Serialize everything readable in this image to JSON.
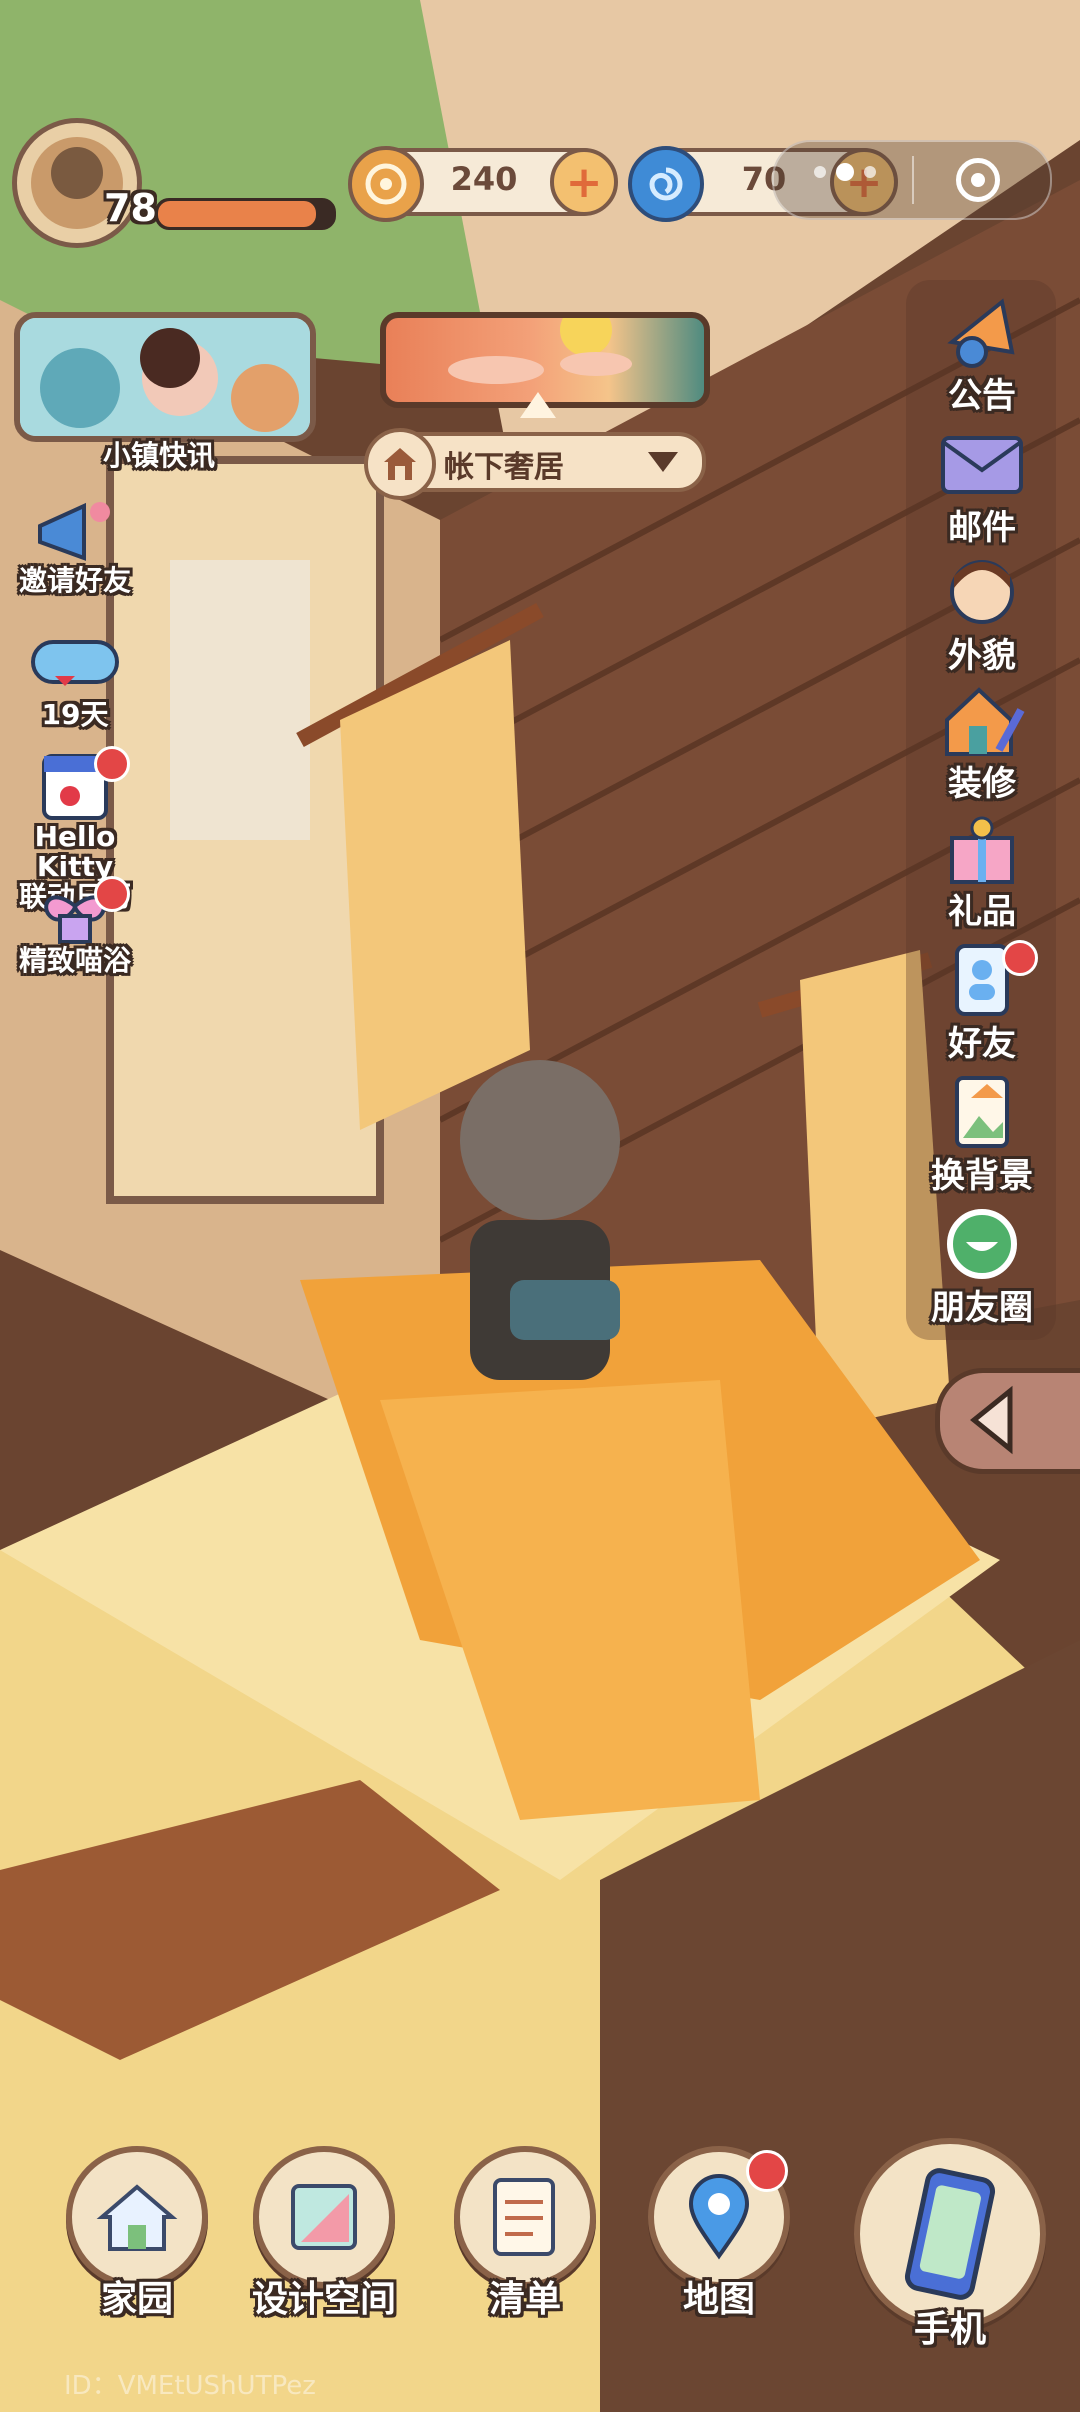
{
  "player": {
    "level": "78",
    "exp_fraction": 0.9
  },
  "currencies": [
    {
      "icon": "coin-icon",
      "value": "240"
    },
    {
      "icon": "swirl-gem-icon",
      "value": "70"
    }
  ],
  "colors": {
    "accent": "#e9824a",
    "outline": "#3b2a22",
    "panel": "#f6ead7",
    "red_dot": "#e34646"
  },
  "banner": {
    "label": "小镇快讯"
  },
  "location": {
    "name": "帐下奢居"
  },
  "left_menu": [
    {
      "icon": "megaphone-icon",
      "label": "邀请好友"
    },
    {
      "icon": "goggles-icon",
      "label": "19天"
    },
    {
      "icon": "calendar-icon",
      "label_line1": "Hello Kitty",
      "label_line2": "联动日历"
    },
    {
      "icon": "bath-ribbon-icon",
      "label": "精致喵浴"
    }
  ],
  "right_menu": [
    {
      "icon": "announcement-icon",
      "label": "公告"
    },
    {
      "icon": "mail-icon",
      "label": "邮件"
    },
    {
      "icon": "appearance-icon",
      "label": "外貌"
    },
    {
      "icon": "decorate-icon",
      "label": "装修"
    },
    {
      "icon": "gift-icon",
      "label": "礼品"
    },
    {
      "icon": "friends-icon",
      "label": "好友"
    },
    {
      "icon": "background-icon",
      "label": "换背景"
    },
    {
      "icon": "moments-icon",
      "label": "朋友圈"
    }
  ],
  "bottom_nav": [
    {
      "icon": "home-icon",
      "label": "家园"
    },
    {
      "icon": "design-icon",
      "label": "设计空间"
    },
    {
      "icon": "list-icon",
      "label": "清单"
    },
    {
      "icon": "map-pin-icon",
      "label": "地图"
    },
    {
      "icon": "phone-icon",
      "label": "手机"
    }
  ],
  "footer": {
    "id_text": "ID：VMEtUShUTPez"
  }
}
